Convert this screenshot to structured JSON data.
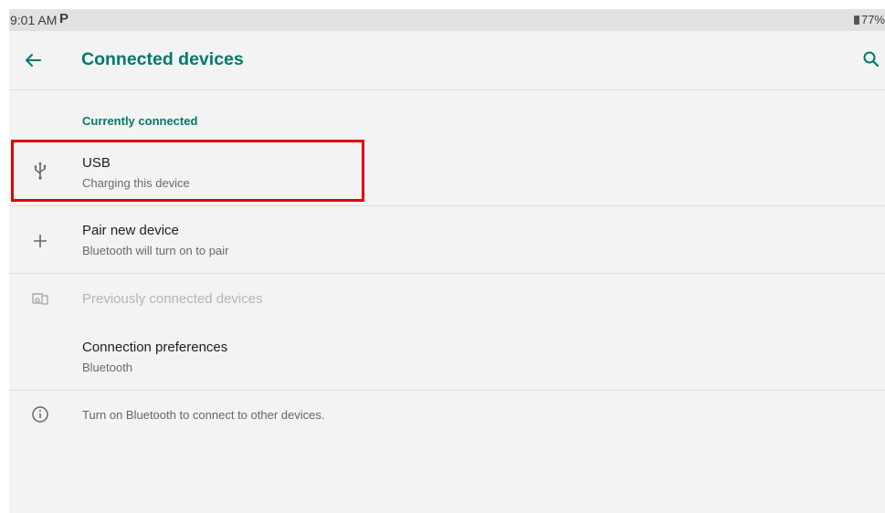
{
  "status_bar": {
    "time": "9:01 AM",
    "notification_glyph": "P",
    "battery": "77%"
  },
  "app_bar": {
    "title": "Connected devices",
    "back_icon": "arrow-back-icon",
    "search_icon": "search-icon"
  },
  "sections": {
    "currently_connected_header": "Currently connected"
  },
  "items": {
    "usb": {
      "title": "USB",
      "summary": "Charging this device",
      "icon": "usb-icon"
    },
    "pair": {
      "title": "Pair new device",
      "summary": "Bluetooth will turn on to pair",
      "icon": "plus-icon"
    },
    "previous": {
      "title": "Previously connected devices",
      "icon": "devices-icon"
    },
    "prefs": {
      "title": "Connection preferences",
      "summary": "Bluetooth"
    }
  },
  "footer": {
    "text": "Turn on Bluetooth to connect to other devices.",
    "icon": "info-icon"
  },
  "colors": {
    "accent": "#00796b",
    "background": "#f3f3f3",
    "highlight": "#e00000"
  }
}
